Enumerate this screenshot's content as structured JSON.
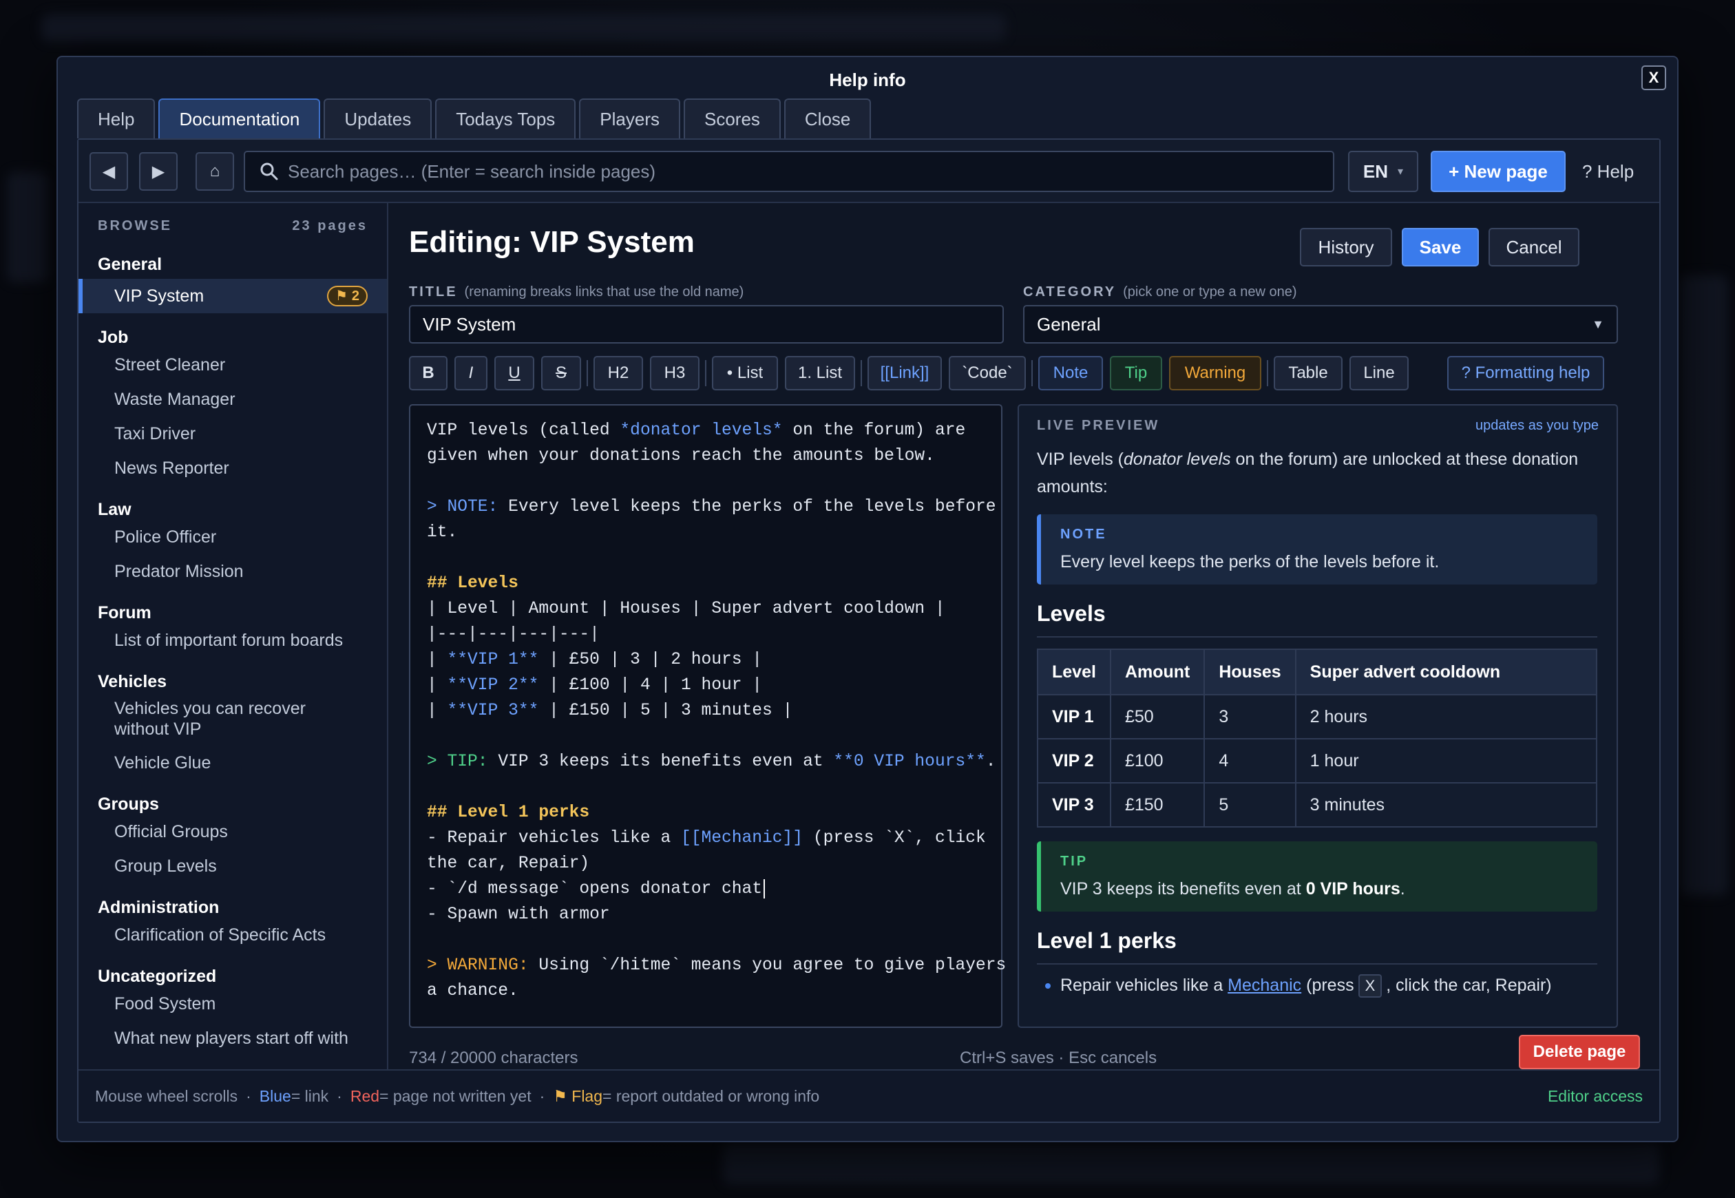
{
  "window": {
    "title": "Help info",
    "close_label": "X"
  },
  "tabs": [
    {
      "label": "Help",
      "active": false
    },
    {
      "label": "Documentation",
      "active": true
    },
    {
      "label": "Updates",
      "active": false
    },
    {
      "label": "Todays Tops",
      "active": false
    },
    {
      "label": "Players",
      "active": false
    },
    {
      "label": "Scores",
      "active": false
    },
    {
      "label": "Close",
      "active": false
    }
  ],
  "toolbar": {
    "back_icon": "◀",
    "forward_icon": "▶",
    "home_icon": "⌂",
    "search_placeholder": "Search pages…  (Enter = search inside pages)",
    "language": "EN",
    "language_caret": "▾",
    "new_page_label": "+ New page",
    "help_label": "? Help"
  },
  "sidebar": {
    "header": "BROWSE",
    "count": "23 pages",
    "categories": [
      {
        "name": "General",
        "items": [
          {
            "label": "VIP System",
            "active": true,
            "flag_count": "2"
          }
        ]
      },
      {
        "name": "Job",
        "items": [
          {
            "label": "Street Cleaner"
          },
          {
            "label": "Waste Manager"
          },
          {
            "label": "Taxi Driver"
          },
          {
            "label": "News Reporter"
          }
        ]
      },
      {
        "name": "Law",
        "items": [
          {
            "label": "Police Officer"
          },
          {
            "label": "Predator Mission"
          }
        ]
      },
      {
        "name": "Forum",
        "items": [
          {
            "label": "List of important forum boards"
          }
        ]
      },
      {
        "name": "Vehicles",
        "items": [
          {
            "label": "Vehicles you can recover without VIP",
            "tall": true
          },
          {
            "label": "Vehicle Glue"
          }
        ]
      },
      {
        "name": "Groups",
        "items": [
          {
            "label": "Official Groups"
          },
          {
            "label": "Group Levels"
          }
        ]
      },
      {
        "name": "Administration",
        "items": [
          {
            "label": "Clarification of Specific Acts"
          }
        ]
      },
      {
        "name": "Uncategorized",
        "items": [
          {
            "label": "Food System"
          },
          {
            "label": "What new players start off with"
          }
        ]
      }
    ]
  },
  "editor_header": {
    "title": "Editing: VIP System",
    "history_label": "History",
    "save_label": "Save",
    "cancel_label": "Cancel"
  },
  "fields": {
    "title_label": "TITLE",
    "title_hint": "(renaming breaks links that use the old name)",
    "title_value": "VIP System",
    "category_label": "CATEGORY",
    "category_hint": "(pick one or type a new one)",
    "category_value": "General"
  },
  "format_buttons": {
    "bold": "B",
    "italic": "I",
    "underline": "U",
    "strike": "S",
    "h2": "H2",
    "h3": "H3",
    "bullet_list": "• List",
    "numbered_list": "1. List",
    "link": "[[Link]]",
    "code": "`Code`",
    "note": "Note",
    "tip": "Tip",
    "warning": "Warning",
    "table": "Table",
    "line": "Line",
    "formatting_help": "? Formatting help"
  },
  "editor_source": {
    "l1a": "VIP levels (called ",
    "l1b": "*donator levels*",
    "l1c": " on the forum) are",
    "l2": "given when your donations reach the amounts below.",
    "l4a": "> NOTE:",
    "l4b": " Every level keeps the perks of the levels before",
    "l5": "it.",
    "l7": "## Levels",
    "l8": "| Level | Amount | Houses | Super advert cooldown |",
    "l9": "|---|---|---|---|",
    "l10a": "| ",
    "l10b": "**VIP 1**",
    "l10c": " | £50 | 3 | 2 hours |",
    "l11a": "| ",
    "l11b": "**VIP 2**",
    "l11c": " | £100 | 4 | 1 hour |",
    "l12a": "| ",
    "l12b": "**VIP 3**",
    "l12c": " | £150 | 5 | 3 minutes |",
    "l14a": "> TIP:",
    "l14b": " VIP 3 keeps its benefits even at ",
    "l14c": "**0 VIP hours**",
    "l14d": ".",
    "l16": "## Level 1 perks",
    "l17a": "- Repair vehicles like a ",
    "l17b": "[[Mechanic]]",
    "l17c": " (press `X`, click",
    "l18": "the car, Repair)",
    "l19": "- `/d message` opens donator chat",
    "l20": "- Spawn with armor",
    "l22a": "> WARNING:",
    "l22b": " Using `/hitme` means you agree to give players",
    "l23": "a chance."
  },
  "preview": {
    "label": "LIVE PREVIEW",
    "live_hint": "updates as you type",
    "intro_a": "VIP levels (",
    "intro_em": "donator levels",
    "intro_b": " on the forum) are unlocked at these donation amounts:",
    "note_title": "NOTE",
    "note_text": "Every level keeps the perks of the levels before it.",
    "levels_heading": "Levels",
    "table_headers": [
      "Level",
      "Amount",
      "Houses",
      "Super advert cooldown"
    ],
    "table_rows": [
      [
        "VIP 1",
        "£50",
        "3",
        "2 hours"
      ],
      [
        "VIP 2",
        "£100",
        "4",
        "1 hour"
      ],
      [
        "VIP 3",
        "£150",
        "5",
        "3 minutes"
      ]
    ],
    "tip_title": "TIP",
    "tip_text_a": "VIP 3 keeps its benefits even at ",
    "tip_text_b": "0 VIP hours",
    "tip_text_c": ".",
    "perks_heading": "Level 1 perks",
    "perk1_a": "Repair vehicles like a ",
    "perk1_link": "Mechanic",
    "perk1_b": " (press",
    "perk1_key": "X",
    "perk1_c": ", click the car, Repair)"
  },
  "status": {
    "char_count": "734 / 20000 characters",
    "shortcut_save": "Ctrl+S saves",
    "shortcut_sep": "·",
    "shortcut_cancel": "Esc cancels",
    "delete_label": "Delete page"
  },
  "footer": {
    "scroll_hint": "Mouse wheel scrolls",
    "sep": "·",
    "blue_word": "Blue",
    "blue_desc": " = link",
    "red_word": "Red",
    "red_desc": " = page not written yet",
    "flag_word": "⚑ Flag",
    "flag_desc": " = report outdated or wrong info",
    "access": "Editor access"
  },
  "colors": {
    "accent": "#3a7bec",
    "danger": "#d63b35",
    "tip": "#4fd18a",
    "warning": "#f3a93a",
    "heading": "#f4c55a"
  }
}
